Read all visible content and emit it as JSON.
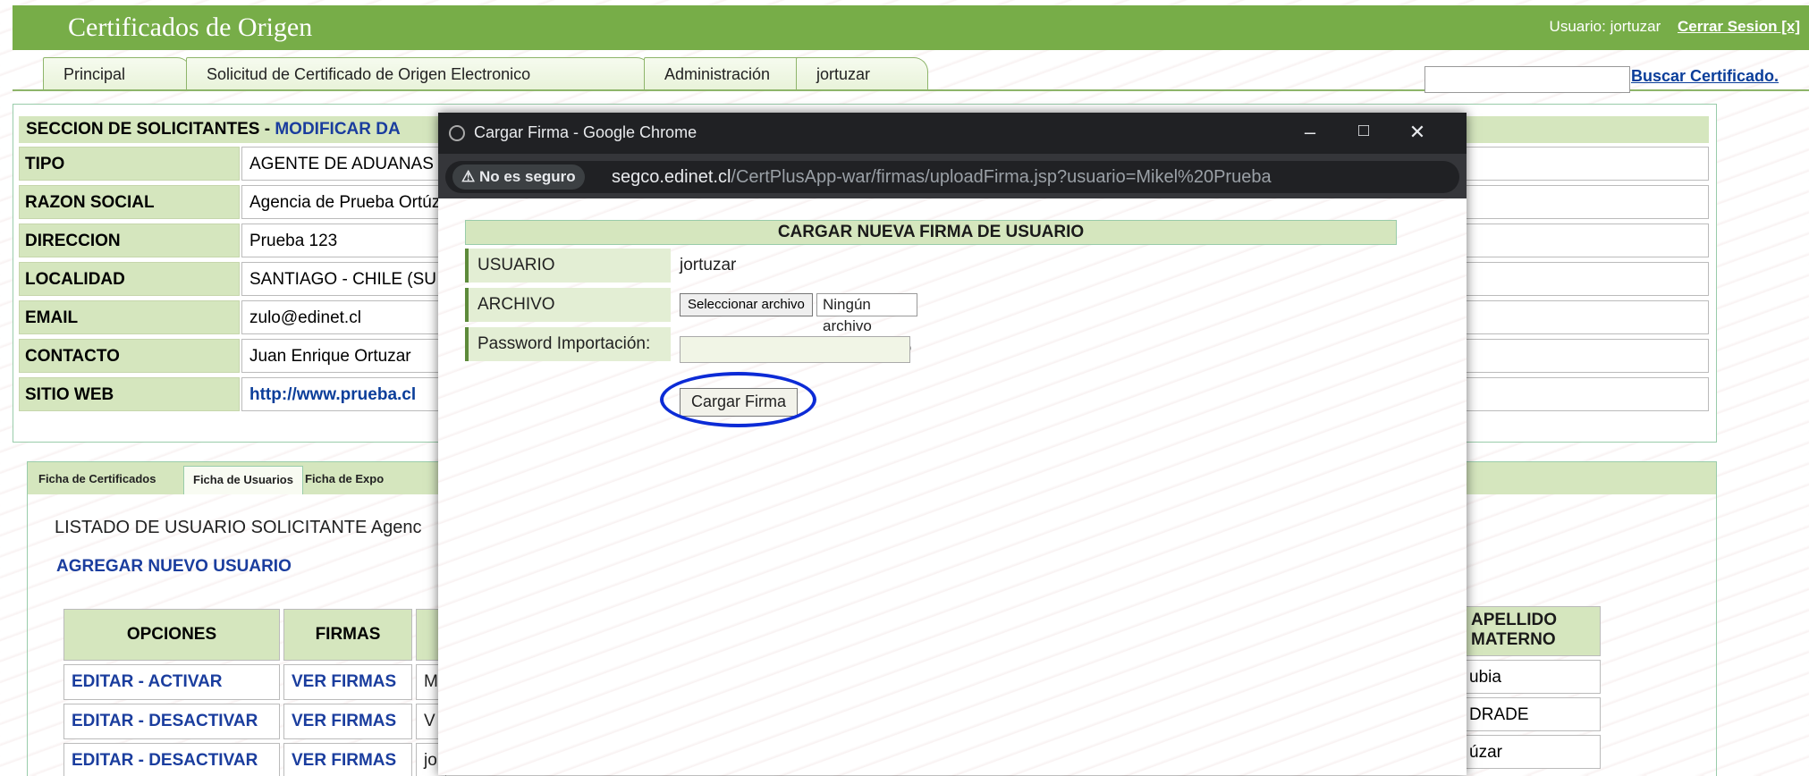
{
  "header": {
    "brand": "Certificados de Origen",
    "user_label": "Usuario: jortuzar",
    "logout": "Cerrar Sesion [x]"
  },
  "nav": {
    "tabs": [
      "Principal",
      "Solicitud de Certificado de Origen Electronico",
      "Administración",
      "jortuzar"
    ],
    "search_value": "",
    "search_link": "Buscar Certificado."
  },
  "section": {
    "title_prefix": "SECCION DE SOLICITANTES - ",
    "title_suffix": "MODIFICAR DA",
    "fields": [
      {
        "label": "TIPO",
        "value": "AGENTE DE ADUANAS"
      },
      {
        "label": "RAZON SOCIAL",
        "value": "Agencia de Prueba Ortúz"
      },
      {
        "label": "DIRECCION",
        "value": "Prueba 123"
      },
      {
        "label": "LOCALIDAD",
        "value": "SANTIAGO - CHILE (SU"
      },
      {
        "label": "EMAIL",
        "value": "zulo@edinet.cl"
      },
      {
        "label": "CONTACTO",
        "value": "Juan Enrique Ortuzar"
      },
      {
        "label": "SITIO WEB",
        "value": "http://www.prueba.cl"
      }
    ]
  },
  "subtabs": [
    "Ficha de Certificados",
    "Ficha de Usuarios",
    "Ficha de Expo"
  ],
  "listing": {
    "title": "LISTADO DE USUARIO SOLICITANTE Agenc",
    "add_user": "AGREGAR NUEVO USUARIO",
    "columns": {
      "opciones": "OPCIONES",
      "firmas": "FIRMAS",
      "apellido": "APELLIDO MATERNO"
    },
    "rows": [
      {
        "opcion": "EDITAR - ACTIVAR",
        "firma": "VER FIRMAS",
        "nombre": "M",
        "apellido": "ubia"
      },
      {
        "opcion": "EDITAR - DESACTIVAR",
        "firma": "VER FIRMAS",
        "nombre": "V",
        "apellido": "DRADE"
      },
      {
        "opcion": "EDITAR - DESACTIVAR",
        "firma": "VER FIRMAS",
        "nombre": "jo",
        "apellido": "úzar"
      }
    ]
  },
  "popup": {
    "window_title": "Cargar Firma - Google Chrome",
    "not_secure": "No es seguro",
    "url_host": "segco.edinet.cl",
    "url_path": "/CertPlusApp-war/firmas/uploadFirma.jsp?usuario=Mikel%20Prueba",
    "heading": "CARGAR NUEVA FIRMA DE USUARIO",
    "usuario_label": "USUARIO",
    "usuario_value": "jortuzar",
    "archivo_label": "ARCHIVO",
    "file_button": "Seleccionar archivo",
    "file_status": "Ningún archivo seleccionado",
    "password_label": "Password Importación:",
    "password_value": "",
    "submit": "Cargar Firma"
  },
  "colors": {
    "header_green": "#77ad48",
    "label_green": "#d5e6be",
    "link_blue": "#1a3d9e",
    "highlight": "#0c2bd6"
  }
}
